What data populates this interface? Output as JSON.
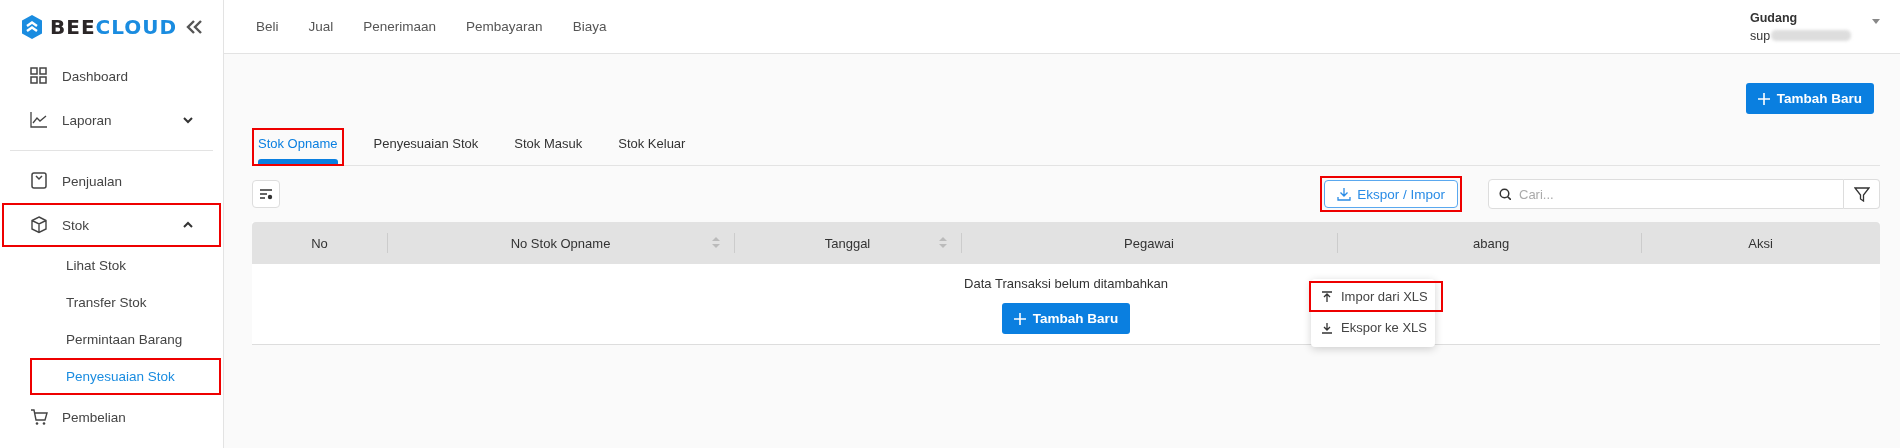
{
  "brand": {
    "name_dark": "BEE",
    "name_accent": "CLOUD"
  },
  "sidebar": {
    "groups": [
      [
        {
          "label": "Dashboard",
          "expandable": false
        },
        {
          "label": "Laporan",
          "expandable": true,
          "expanded": false,
          "highlighted": false
        }
      ],
      [
        {
          "label": "Penjualan",
          "expandable": false
        },
        {
          "label": "Stok",
          "expandable": true,
          "expanded": true,
          "highlighted": true,
          "children": [
            {
              "label": "Lihat Stok",
              "selected": false,
              "highlighted": false
            },
            {
              "label": "Transfer Stok",
              "selected": false,
              "highlighted": false
            },
            {
              "label": "Permintaan Barang",
              "selected": false,
              "highlighted": false
            },
            {
              "label": "Penyesuaian Stok",
              "selected": true,
              "highlighted": true
            }
          ]
        },
        {
          "label": "Pembelian",
          "expandable": false
        }
      ]
    ]
  },
  "top_nav": [
    "Beli",
    "Jual",
    "Penerimaan",
    "Pembayaran",
    "Biaya"
  ],
  "user": {
    "title": "Gudang",
    "subtitle": "sup"
  },
  "add_button": "Tambah Baru",
  "tabs": [
    {
      "label": "Stok Opname",
      "selected": true,
      "highlighted": true
    },
    {
      "label": "Penyesuaian Stok",
      "selected": false,
      "highlighted": false
    },
    {
      "label": "Stok Masuk",
      "selected": false,
      "highlighted": false
    },
    {
      "label": "Stok Keluar",
      "selected": false,
      "highlighted": false
    }
  ],
  "export_button": {
    "label": "Ekspor / Impor",
    "highlighted": true
  },
  "export_menu": [
    {
      "label": "Impor dari XLS",
      "highlighted": true
    },
    {
      "label": "Ekspor ke XLS",
      "highlighted": false
    }
  ],
  "search": {
    "placeholder": "Cari..."
  },
  "table": {
    "columns": [
      {
        "label": "No",
        "sortable": false
      },
      {
        "label": "No Stok Opname",
        "sortable": true
      },
      {
        "label": "Tanggal",
        "sortable": true
      },
      {
        "label": "Pegawai",
        "sortable": false
      },
      {
        "label": "abang",
        "sortable": false
      },
      {
        "label": "Aksi",
        "sortable": false
      }
    ],
    "empty_message": "Data Transaksi belum ditambahkan",
    "empty_button": "Tambah Baru"
  }
}
